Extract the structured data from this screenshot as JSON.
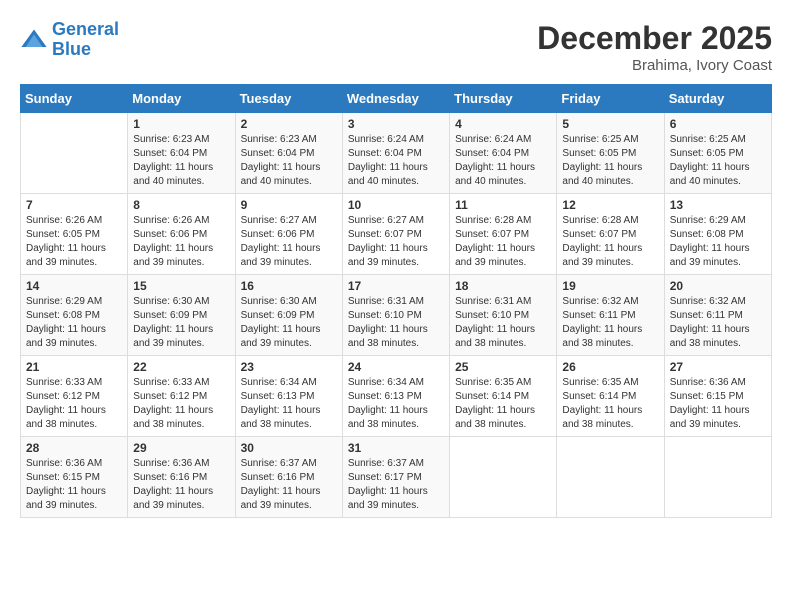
{
  "header": {
    "logo_line1": "General",
    "logo_line2": "Blue",
    "month": "December 2025",
    "location": "Brahima, Ivory Coast"
  },
  "weekdays": [
    "Sunday",
    "Monday",
    "Tuesday",
    "Wednesday",
    "Thursday",
    "Friday",
    "Saturday"
  ],
  "weeks": [
    [
      {
        "day": "",
        "sunrise": "",
        "sunset": "",
        "daylight": ""
      },
      {
        "day": "1",
        "sunrise": "Sunrise: 6:23 AM",
        "sunset": "Sunset: 6:04 PM",
        "daylight": "Daylight: 11 hours and 40 minutes."
      },
      {
        "day": "2",
        "sunrise": "Sunrise: 6:23 AM",
        "sunset": "Sunset: 6:04 PM",
        "daylight": "Daylight: 11 hours and 40 minutes."
      },
      {
        "day": "3",
        "sunrise": "Sunrise: 6:24 AM",
        "sunset": "Sunset: 6:04 PM",
        "daylight": "Daylight: 11 hours and 40 minutes."
      },
      {
        "day": "4",
        "sunrise": "Sunrise: 6:24 AM",
        "sunset": "Sunset: 6:04 PM",
        "daylight": "Daylight: 11 hours and 40 minutes."
      },
      {
        "day": "5",
        "sunrise": "Sunrise: 6:25 AM",
        "sunset": "Sunset: 6:05 PM",
        "daylight": "Daylight: 11 hours and 40 minutes."
      },
      {
        "day": "6",
        "sunrise": "Sunrise: 6:25 AM",
        "sunset": "Sunset: 6:05 PM",
        "daylight": "Daylight: 11 hours and 40 minutes."
      }
    ],
    [
      {
        "day": "7",
        "sunrise": "Sunrise: 6:26 AM",
        "sunset": "Sunset: 6:05 PM",
        "daylight": "Daylight: 11 hours and 39 minutes."
      },
      {
        "day": "8",
        "sunrise": "Sunrise: 6:26 AM",
        "sunset": "Sunset: 6:06 PM",
        "daylight": "Daylight: 11 hours and 39 minutes."
      },
      {
        "day": "9",
        "sunrise": "Sunrise: 6:27 AM",
        "sunset": "Sunset: 6:06 PM",
        "daylight": "Daylight: 11 hours and 39 minutes."
      },
      {
        "day": "10",
        "sunrise": "Sunrise: 6:27 AM",
        "sunset": "Sunset: 6:07 PM",
        "daylight": "Daylight: 11 hours and 39 minutes."
      },
      {
        "day": "11",
        "sunrise": "Sunrise: 6:28 AM",
        "sunset": "Sunset: 6:07 PM",
        "daylight": "Daylight: 11 hours and 39 minutes."
      },
      {
        "day": "12",
        "sunrise": "Sunrise: 6:28 AM",
        "sunset": "Sunset: 6:07 PM",
        "daylight": "Daylight: 11 hours and 39 minutes."
      },
      {
        "day": "13",
        "sunrise": "Sunrise: 6:29 AM",
        "sunset": "Sunset: 6:08 PM",
        "daylight": "Daylight: 11 hours and 39 minutes."
      }
    ],
    [
      {
        "day": "14",
        "sunrise": "Sunrise: 6:29 AM",
        "sunset": "Sunset: 6:08 PM",
        "daylight": "Daylight: 11 hours and 39 minutes."
      },
      {
        "day": "15",
        "sunrise": "Sunrise: 6:30 AM",
        "sunset": "Sunset: 6:09 PM",
        "daylight": "Daylight: 11 hours and 39 minutes."
      },
      {
        "day": "16",
        "sunrise": "Sunrise: 6:30 AM",
        "sunset": "Sunset: 6:09 PM",
        "daylight": "Daylight: 11 hours and 39 minutes."
      },
      {
        "day": "17",
        "sunrise": "Sunrise: 6:31 AM",
        "sunset": "Sunset: 6:10 PM",
        "daylight": "Daylight: 11 hours and 38 minutes."
      },
      {
        "day": "18",
        "sunrise": "Sunrise: 6:31 AM",
        "sunset": "Sunset: 6:10 PM",
        "daylight": "Daylight: 11 hours and 38 minutes."
      },
      {
        "day": "19",
        "sunrise": "Sunrise: 6:32 AM",
        "sunset": "Sunset: 6:11 PM",
        "daylight": "Daylight: 11 hours and 38 minutes."
      },
      {
        "day": "20",
        "sunrise": "Sunrise: 6:32 AM",
        "sunset": "Sunset: 6:11 PM",
        "daylight": "Daylight: 11 hours and 38 minutes."
      }
    ],
    [
      {
        "day": "21",
        "sunrise": "Sunrise: 6:33 AM",
        "sunset": "Sunset: 6:12 PM",
        "daylight": "Daylight: 11 hours and 38 minutes."
      },
      {
        "day": "22",
        "sunrise": "Sunrise: 6:33 AM",
        "sunset": "Sunset: 6:12 PM",
        "daylight": "Daylight: 11 hours and 38 minutes."
      },
      {
        "day": "23",
        "sunrise": "Sunrise: 6:34 AM",
        "sunset": "Sunset: 6:13 PM",
        "daylight": "Daylight: 11 hours and 38 minutes."
      },
      {
        "day": "24",
        "sunrise": "Sunrise: 6:34 AM",
        "sunset": "Sunset: 6:13 PM",
        "daylight": "Daylight: 11 hours and 38 minutes."
      },
      {
        "day": "25",
        "sunrise": "Sunrise: 6:35 AM",
        "sunset": "Sunset: 6:14 PM",
        "daylight": "Daylight: 11 hours and 38 minutes."
      },
      {
        "day": "26",
        "sunrise": "Sunrise: 6:35 AM",
        "sunset": "Sunset: 6:14 PM",
        "daylight": "Daylight: 11 hours and 38 minutes."
      },
      {
        "day": "27",
        "sunrise": "Sunrise: 6:36 AM",
        "sunset": "Sunset: 6:15 PM",
        "daylight": "Daylight: 11 hours and 39 minutes."
      }
    ],
    [
      {
        "day": "28",
        "sunrise": "Sunrise: 6:36 AM",
        "sunset": "Sunset: 6:15 PM",
        "daylight": "Daylight: 11 hours and 39 minutes."
      },
      {
        "day": "29",
        "sunrise": "Sunrise: 6:36 AM",
        "sunset": "Sunset: 6:16 PM",
        "daylight": "Daylight: 11 hours and 39 minutes."
      },
      {
        "day": "30",
        "sunrise": "Sunrise: 6:37 AM",
        "sunset": "Sunset: 6:16 PM",
        "daylight": "Daylight: 11 hours and 39 minutes."
      },
      {
        "day": "31",
        "sunrise": "Sunrise: 6:37 AM",
        "sunset": "Sunset: 6:17 PM",
        "daylight": "Daylight: 11 hours and 39 minutes."
      },
      {
        "day": "",
        "sunrise": "",
        "sunset": "",
        "daylight": ""
      },
      {
        "day": "",
        "sunrise": "",
        "sunset": "",
        "daylight": ""
      },
      {
        "day": "",
        "sunrise": "",
        "sunset": "",
        "daylight": ""
      }
    ]
  ]
}
